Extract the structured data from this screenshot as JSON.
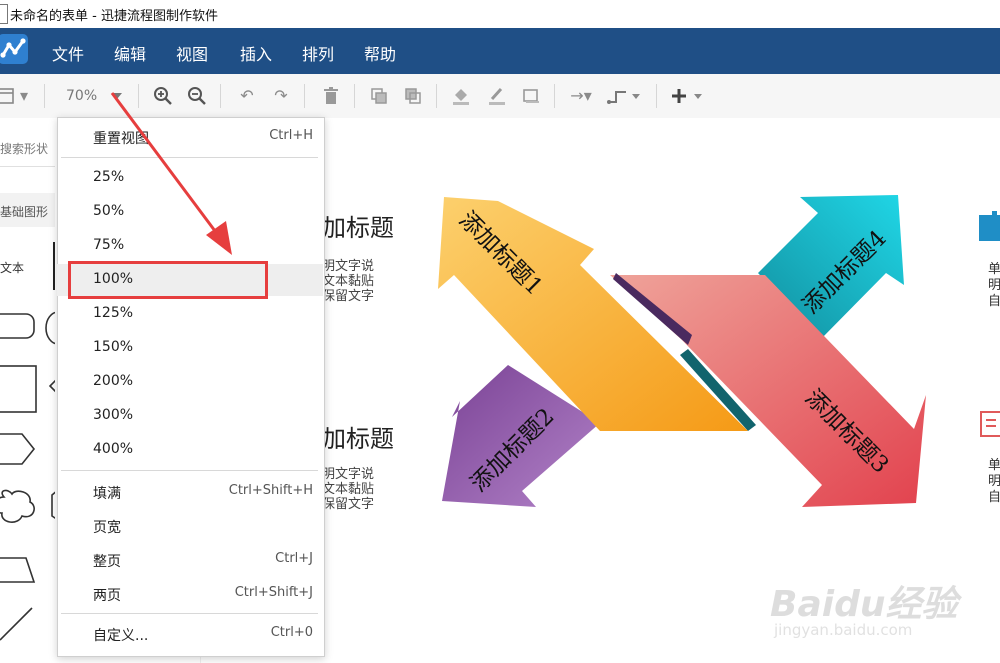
{
  "window": {
    "title": "未命名的表单 - 迅捷流程图制作软件"
  },
  "menubar": {
    "items": [
      {
        "label": "文件"
      },
      {
        "label": "编辑"
      },
      {
        "label": "视图"
      },
      {
        "label": "插入"
      },
      {
        "label": "排列"
      },
      {
        "label": "帮助"
      }
    ]
  },
  "toolbar": {
    "zoom": "70%"
  },
  "sidebar": {
    "search_placeholder": "搜索形状",
    "section": "基础图形",
    "text_shape": "文本"
  },
  "zoom_menu": {
    "reset": {
      "label": "重置视图",
      "shortcut": "Ctrl+H"
    },
    "levels": [
      "25%",
      "50%",
      "75%",
      "100%",
      "125%",
      "150%",
      "200%",
      "300%",
      "400%"
    ],
    "selected": "100%",
    "fill": {
      "label": "填满",
      "shortcut": "Ctrl+Shift+H"
    },
    "page_width": {
      "label": "页宽",
      "shortcut": ""
    },
    "whole_page": {
      "label": "整页",
      "shortcut": "Ctrl+J"
    },
    "two_pages": {
      "label": "两页",
      "shortcut": "Ctrl+Shift+J"
    },
    "custom": {
      "label": "自定义...",
      "shortcut": "Ctrl+0"
    }
  },
  "canvas": {
    "heading_top": "加标题",
    "body_top": [
      "明文字说",
      "文本黏贴",
      "保留文字"
    ],
    "heading_bottom": "加标题",
    "body_bottom": [
      "明文字说",
      "文本黏贴",
      "保留文字"
    ],
    "arrows": [
      "添加标题1",
      "添加标题2",
      "添加标题3",
      "添加标题4"
    ],
    "right_text_top": [
      "单",
      "明",
      "自"
    ],
    "right_text_bottom": [
      "单",
      "明",
      "自"
    ]
  },
  "watermark": {
    "logo": "Baidu经验",
    "url": "jingyan.baidu.com"
  },
  "colors": {
    "menubar": "#1f4f86",
    "arrow1": "#f7a21b",
    "arrow2": "#9a5fb0",
    "arrow3": "#e34a55",
    "arrow4": "#1fc2d2",
    "highlight": "#e63e3e"
  }
}
